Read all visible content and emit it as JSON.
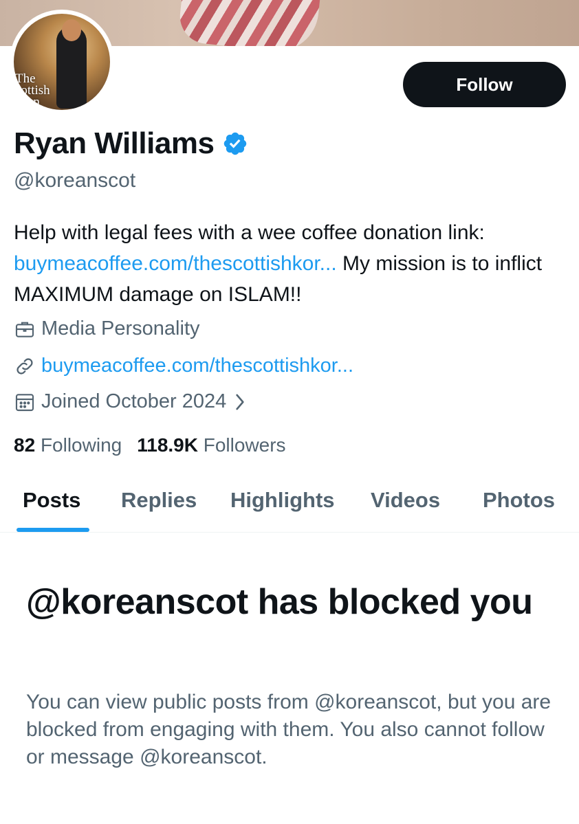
{
  "profile": {
    "display_name": "Ryan Williams",
    "handle": "@koreanscot",
    "avatar_text": "The\ncottish\n  ean",
    "follow_label": "Follow",
    "bio_text": "Help with legal fees with a wee coffee donation link: ",
    "bio_link": "buymeacoffee.com/thescottishkor...",
    "bio_text_after": " My mission is to inflict MAXIMUM damage on ISLAM!!",
    "category": "Media Personality",
    "website": "buymeacoffee.com/thescottishkor...",
    "joined": "Joined October 2024",
    "following_count": "82",
    "following_label": "Following",
    "followers_count": "118.9K",
    "followers_label": "Followers"
  },
  "tabs": [
    {
      "label": "Posts",
      "active": true
    },
    {
      "label": "Replies",
      "active": false
    },
    {
      "label": "Highlights",
      "active": false
    },
    {
      "label": "Videos",
      "active": false
    },
    {
      "label": "Photos",
      "active": false
    }
  ],
  "blocked": {
    "title": "@koreanscot has blocked you",
    "description": "You can view public posts from @koreanscot, but you are blocked from engaging with them. You also cannot follow or message @koreanscot."
  },
  "colors": {
    "accent": "#1d9bf0",
    "text_primary": "#0f1419",
    "text_secondary": "#536471",
    "button_bg": "#0f1419"
  },
  "icons": {
    "verified": "verified-badge-icon",
    "category": "briefcase-icon",
    "website": "link-icon",
    "joined": "calendar-icon",
    "chevron": "chevron-right-icon"
  }
}
